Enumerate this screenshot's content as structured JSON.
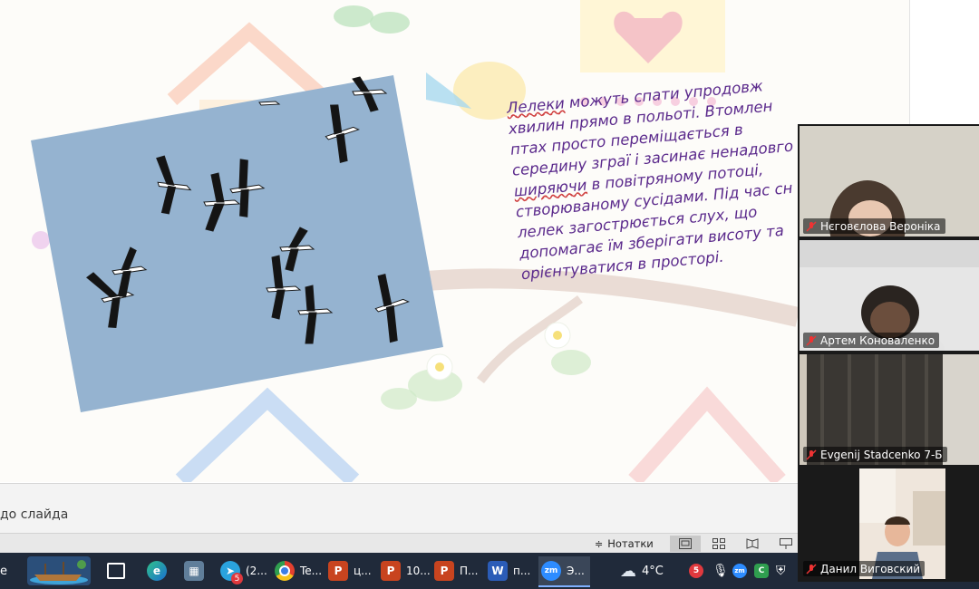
{
  "slide": {
    "text_lines": [
      {
        "pre": "",
        "sq": "Лелеки",
        "post": " можуть спати упродовж"
      },
      {
        "pre": "хвилин прямо в польоті. Втомлен",
        "sq": "",
        "post": ""
      },
      {
        "pre": "птах просто переміщається в",
        "sq": "",
        "post": ""
      },
      {
        "pre": "середину зграї і засинає ненадовго",
        "sq": "",
        "post": ""
      },
      {
        "pre": "",
        "sq": "ширяючи",
        "post": " в повітряному потоці,"
      },
      {
        "pre": "створюваному сусідами. Під час сн",
        "sq": "",
        "post": ""
      },
      {
        "pre": "лелек загострюється слух, що",
        "sq": "",
        "post": ""
      },
      {
        "pre": "допомагає їм зберігати висоту та",
        "sq": "",
        "post": ""
      },
      {
        "pre": "орієнтуватися в просторі.",
        "sq": "",
        "post": ""
      }
    ]
  },
  "notes": {
    "placeholder": "до слайда"
  },
  "status_bar": {
    "notes_label": "Нотатки"
  },
  "taskbar": {
    "left_label": "e",
    "apps": [
      {
        "name": "telegram",
        "label": "(2...",
        "badge": "5"
      },
      {
        "name": "chrome",
        "label": "Te..."
      },
      {
        "name": "powerpoint-1",
        "label": "ц..."
      },
      {
        "name": "powerpoint-2",
        "label": "10..."
      },
      {
        "name": "powerpoint-3",
        "label": "П..."
      },
      {
        "name": "word",
        "label": "п..."
      },
      {
        "name": "zoom",
        "label": "Э..."
      }
    ],
    "weather": "4°C",
    "tray_badge": "5"
  },
  "participants": [
    {
      "name": "Нєговєлова Вероніка"
    },
    {
      "name": "Артем Коноваленко"
    },
    {
      "name": "Evgenij Stadcenko 7-Б"
    },
    {
      "name": "Данил Виговский"
    }
  ]
}
